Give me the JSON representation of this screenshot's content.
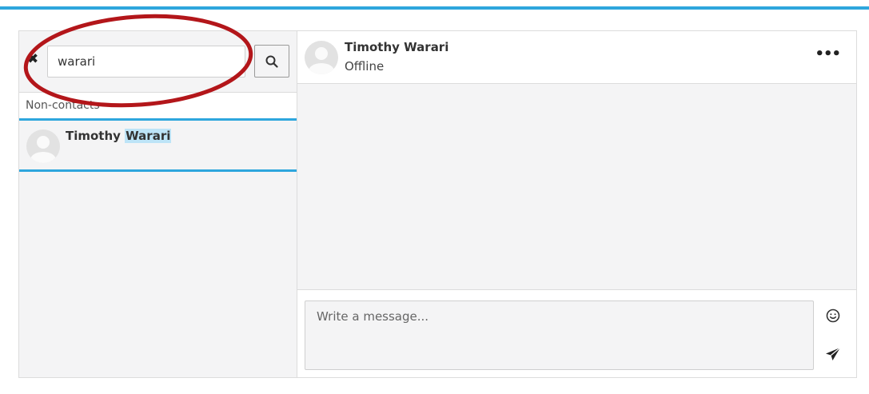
{
  "search": {
    "value": "warari",
    "clear_icon": "close-icon",
    "button_icon": "search-icon"
  },
  "results": {
    "section_title": "Non-contacts",
    "items": [
      {
        "name_prefix": "Timothy ",
        "name_match": "Warari"
      }
    ]
  },
  "chat": {
    "contact_name": "Timothy Warari",
    "contact_status": "Offline",
    "more_label": "•••",
    "message_placeholder": "Write a message...",
    "emoji_icon": "smiley-icon",
    "send_icon": "paper-plane-icon"
  },
  "colors": {
    "accent": "#2ea6dd",
    "annotation": "#b3161a",
    "match_highlight": "#bde4f7"
  }
}
